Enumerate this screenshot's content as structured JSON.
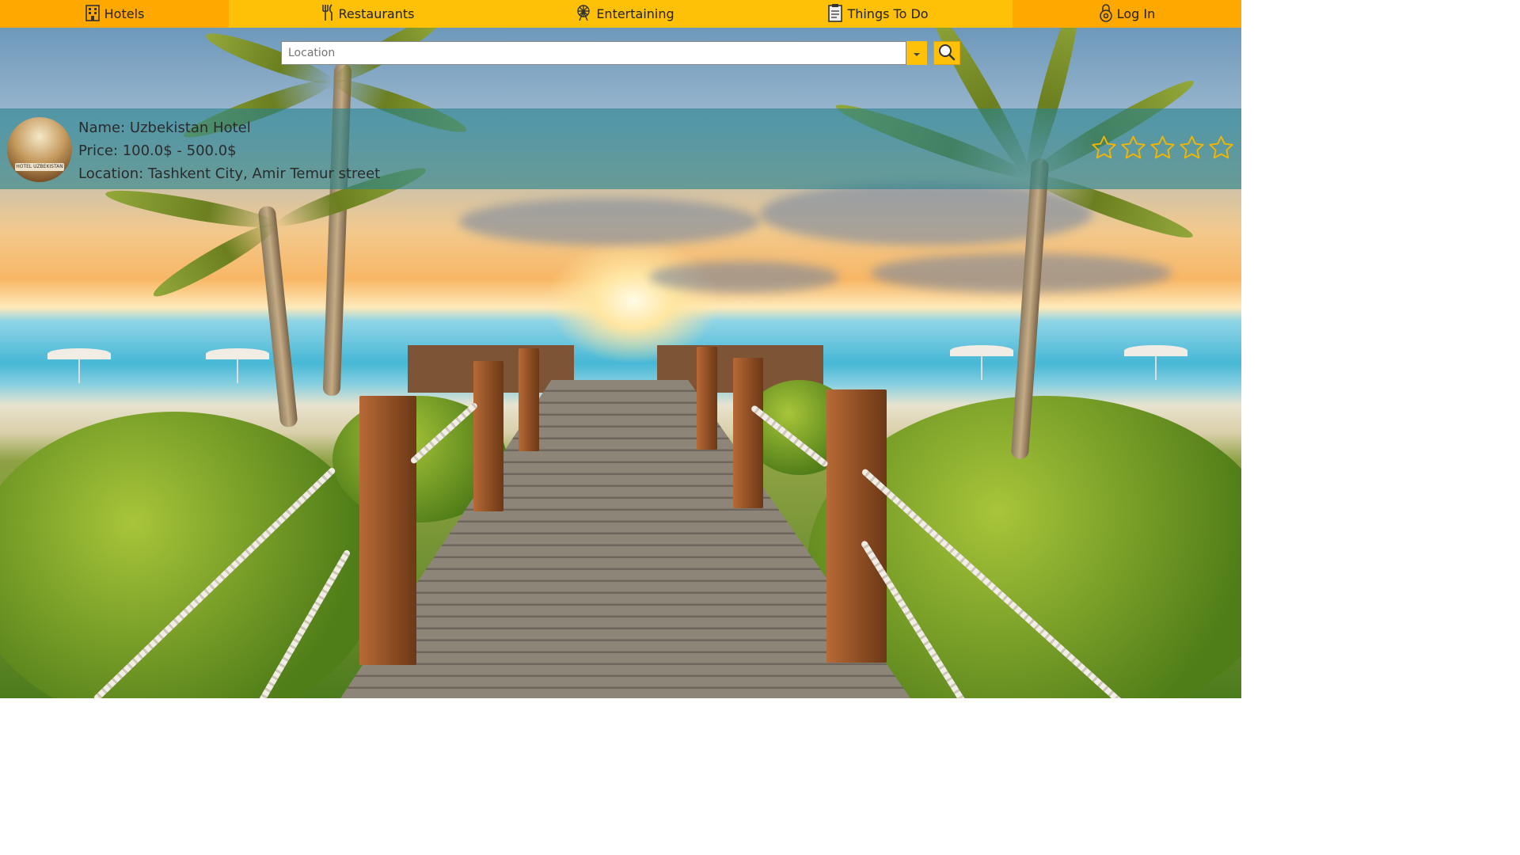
{
  "nav": {
    "items": [
      {
        "label": "Hotels",
        "icon": "building-icon"
      },
      {
        "label": "Restaurants",
        "icon": "cutlery-icon"
      },
      {
        "label": "Entertaining",
        "icon": "ferris-wheel-icon"
      },
      {
        "label": "Things To Do",
        "icon": "clipboard-icon"
      },
      {
        "label": "Log In",
        "icon": "lock-icon"
      }
    ],
    "colors": {
      "bar": "#ffc107",
      "edge": "#ffa800"
    }
  },
  "search": {
    "placeholder": "Location",
    "value": ""
  },
  "result": {
    "name_line": "Name: Uzbekistan Hotel",
    "price_line": "Price: 100.0$ - 500.0$",
    "location_line": "Location: Tashkent City, Amir Temur street",
    "thumbnail_caption": "HOTEL UZBEKISTAN",
    "rating": {
      "filled": 0,
      "max": 5
    }
  }
}
